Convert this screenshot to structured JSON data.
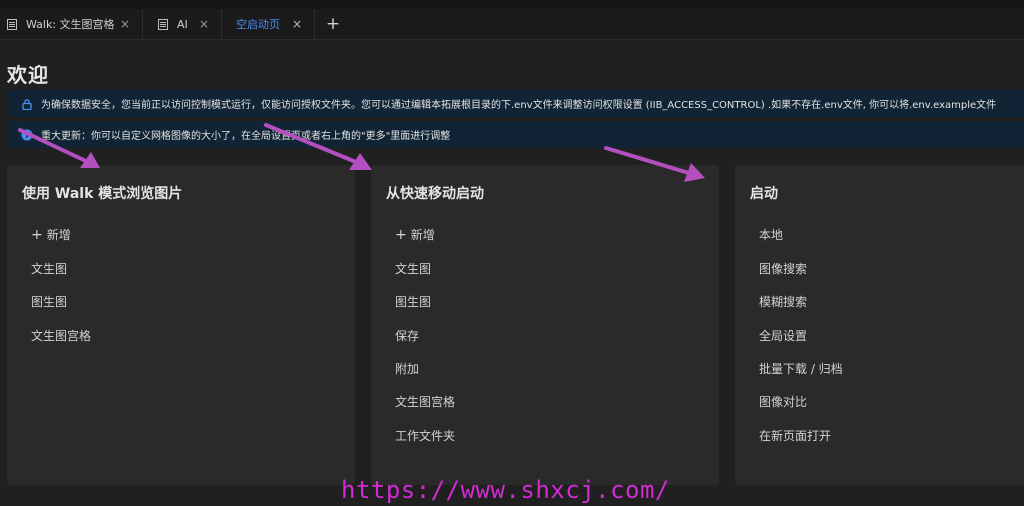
{
  "colors": {
    "accent": "#4a8ff0",
    "notice_bg": "#102435",
    "card_bg": "#2a2a2b",
    "arrow": "#b44fbf",
    "watermark": "#d12bd1"
  },
  "tabs": [
    {
      "label": "Walk: 文生图宫格",
      "icon": "document-icon",
      "close": "×"
    },
    {
      "label": "AI",
      "icon": "document-icon",
      "close": "×"
    },
    {
      "label": "空启动页",
      "close": "×",
      "active": true
    }
  ],
  "add_tab": "+",
  "page_title": "欢迎",
  "notices": [
    {
      "icon": "lock-icon",
      "text": "为确保数据安全，您当前正以访问控制模式运行，仅能访问授权文件夹。您可以通过编辑本拓展根目录的下.env文件来调整访问权限设置 (IIB_ACCESS_CONTROL) .如果不存在.env文件, 你可以将.env.example文件"
    },
    {
      "icon": "info-icon",
      "text": "重大更新：你可以自定义网格图像的大小了，在全局设置页或者右上角的\"更多\"里面进行调整"
    }
  ],
  "cards": [
    {
      "title": "使用 Walk 模式浏览图片",
      "items": [
        {
          "label": "新增",
          "icon": "plus-icon"
        },
        {
          "label": "文生图"
        },
        {
          "label": "图生图"
        },
        {
          "label": "文生图宫格"
        }
      ]
    },
    {
      "title": "从快速移动启动",
      "items": [
        {
          "label": "新增",
          "icon": "plus-icon"
        },
        {
          "label": "文生图"
        },
        {
          "label": "图生图"
        },
        {
          "label": "保存"
        },
        {
          "label": "附加"
        },
        {
          "label": "文生图宫格"
        },
        {
          "label": "工作文件夹"
        }
      ]
    },
    {
      "title": "启动",
      "items": [
        {
          "label": "本地"
        },
        {
          "label": "图像搜索"
        },
        {
          "label": "模糊搜索"
        },
        {
          "label": "全局设置"
        },
        {
          "label": "批量下载 / 归档"
        },
        {
          "label": "图像对比"
        },
        {
          "label": "在新页面打开"
        }
      ]
    }
  ],
  "watermark": "https://www.shxcj.com/"
}
